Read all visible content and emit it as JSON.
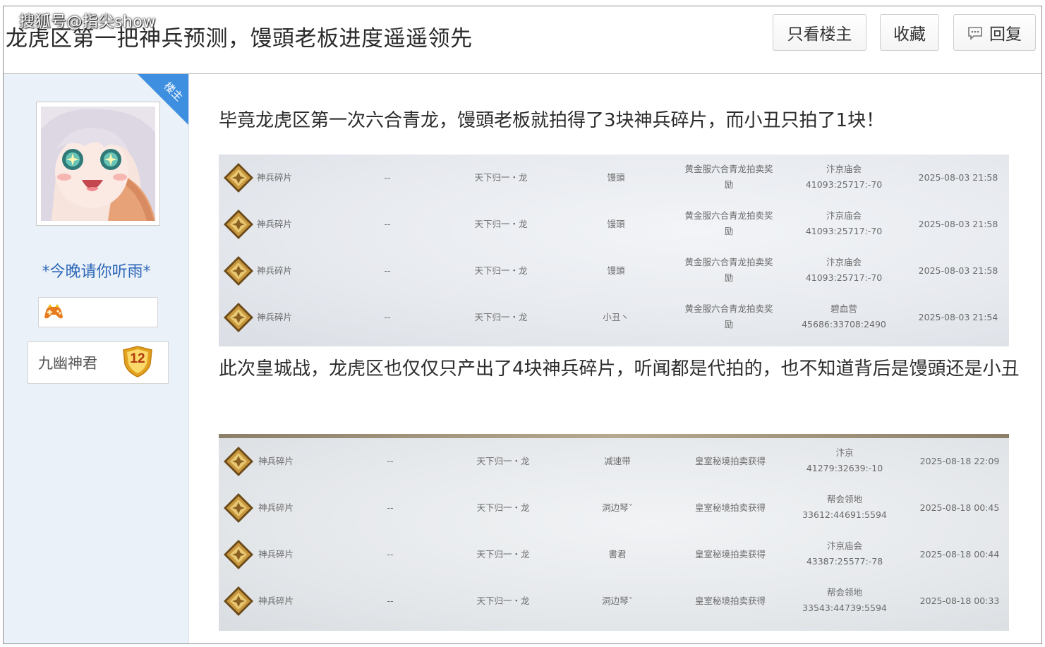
{
  "watermark": "搜狐号@指尖show",
  "post": {
    "title": "龙虎区第一把神兵预测，馒頭老板进度遥遥领先"
  },
  "toolbar": {
    "only_op": "只看楼主",
    "favorite": "收藏",
    "reply": "回复"
  },
  "author": {
    "op_tag": "楼主",
    "name": "*今晚请你听雨*",
    "title": "九幽神君",
    "level": "12"
  },
  "content": {
    "paragraph1": "毕竟龙虎区第一次六合青龙，馒頭老板就拍得了3块神兵碎片，而小丑只拍了1块！",
    "paragraph2": "此次皇城战，龙虎区也仅仅只产出了4块神兵碎片，听闻都是代拍的，也不知道背后是馒頭还是小丑"
  },
  "table1": {
    "rows": [
      {
        "item": "神兵碎片",
        "dash": "--",
        "server": "天下归一・龙",
        "buyer": "馒頭",
        "source1": "黄金服六合青龙拍卖奖",
        "source2": "励",
        "guild": "汴京庙会",
        "code": "41093:25717:-70",
        "time": "2025-08-03 21:58"
      },
      {
        "item": "神兵碎片",
        "dash": "--",
        "server": "天下归一・龙",
        "buyer": "馒頭",
        "source1": "黄金服六合青龙拍卖奖",
        "source2": "励",
        "guild": "汴京庙会",
        "code": "41093:25717:-70",
        "time": "2025-08-03 21:58"
      },
      {
        "item": "神兵碎片",
        "dash": "--",
        "server": "天下归一・龙",
        "buyer": "馒頭",
        "source1": "黄金服六合青龙拍卖奖",
        "source2": "励",
        "guild": "汴京庙会",
        "code": "41093:25717:-70",
        "time": "2025-08-03 21:58"
      },
      {
        "item": "神兵碎片",
        "dash": "--",
        "server": "天下归一・龙",
        "buyer": "小丑丶",
        "source1": "黄金服六合青龙拍卖奖",
        "source2": "励",
        "guild": "碧血营",
        "code": "45686:33708:2490",
        "time": "2025-08-03 21:54"
      }
    ]
  },
  "table2": {
    "rows": [
      {
        "item": "神兵碎片",
        "dash": "--",
        "server": "天下归一・龙",
        "buyer": "减速带",
        "source": "皇室秘境拍卖获得",
        "guild": "汴京",
        "code": "41279:32639:-10",
        "time": "2025-08-18 22:09"
      },
      {
        "item": "神兵碎片",
        "dash": "--",
        "server": "天下归一・龙",
        "buyer": "洞边琴ˇ",
        "source": "皇室秘境拍卖获得",
        "guild": "帮会领地",
        "code": "33612:44691:5594",
        "time": "2025-08-18 00:45"
      },
      {
        "item": "神兵碎片",
        "dash": "--",
        "server": "天下归一・龙",
        "buyer": "書君",
        "source": "皇室秘境拍卖获得",
        "guild": "汴京庙会",
        "code": "43387:25577:-78",
        "time": "2025-08-18 00:44"
      },
      {
        "item": "神兵碎片",
        "dash": "--",
        "server": "天下归一・龙",
        "buyer": "洞边琴ˇ",
        "source": "皇室秘境拍卖获得",
        "guild": "帮会领地",
        "code": "33543:44739:5594",
        "time": "2025-08-18 00:33"
      }
    ]
  },
  "icons": {
    "item_icon": "golden-diamond-fragment-icon",
    "reply_icon": "speech-bubble-icon",
    "medal_icon": "gamepad-medal-icon",
    "level_icon": "shield-level-icon"
  },
  "colors": {
    "username": "#2b66b8",
    "op_tag": "#3f8fe0",
    "sidebar_bg": "#ebf1f8"
  }
}
